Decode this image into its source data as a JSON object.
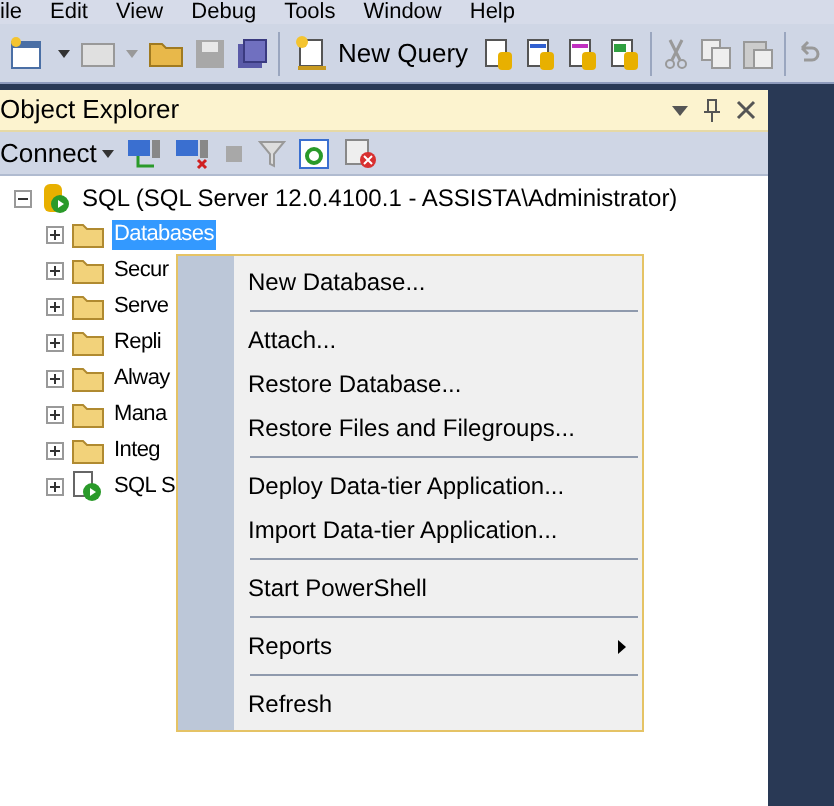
{
  "menu_bar": [
    "ile",
    "Edit",
    "View",
    "Debug",
    "Tools",
    "Window",
    "Help"
  ],
  "toolbar": {
    "new_query": "New Query"
  },
  "object_explorer": {
    "title": "Object Explorer",
    "connect": "Connect",
    "tree": {
      "label": "SQL (SQL Server 12.0.4100.1 - ASSISTA\\Administrator)",
      "expanded": true,
      "children": [
        {
          "label": "Databases",
          "selected": true,
          "kind": "folder"
        },
        {
          "label": "Secur",
          "selected": false,
          "kind": "folder"
        },
        {
          "label": "Serve",
          "selected": false,
          "kind": "folder"
        },
        {
          "label": "Repli",
          "selected": false,
          "kind": "folder"
        },
        {
          "label": "Alway",
          "selected": false,
          "kind": "folder"
        },
        {
          "label": "Mana",
          "selected": false,
          "kind": "folder"
        },
        {
          "label": "Integ",
          "selected": false,
          "kind": "folder"
        },
        {
          "label": "SQL S",
          "selected": false,
          "kind": "agent"
        }
      ]
    }
  },
  "context_menu": [
    {
      "kind": "item",
      "label": "New Database...",
      "submenu": false
    },
    {
      "kind": "separator"
    },
    {
      "kind": "item",
      "label": "Attach...",
      "submenu": false
    },
    {
      "kind": "item",
      "label": "Restore Database...",
      "submenu": false
    },
    {
      "kind": "item",
      "label": "Restore Files and Filegroups...",
      "submenu": false
    },
    {
      "kind": "separator"
    },
    {
      "kind": "item",
      "label": "Deploy Data-tier Application...",
      "submenu": false
    },
    {
      "kind": "item",
      "label": "Import Data-tier Application...",
      "submenu": false
    },
    {
      "kind": "separator"
    },
    {
      "kind": "item",
      "label": "Start PowerShell",
      "submenu": false
    },
    {
      "kind": "separator"
    },
    {
      "kind": "item",
      "label": "Reports",
      "submenu": true
    },
    {
      "kind": "separator"
    },
    {
      "kind": "item",
      "label": "Refresh",
      "submenu": false
    }
  ]
}
